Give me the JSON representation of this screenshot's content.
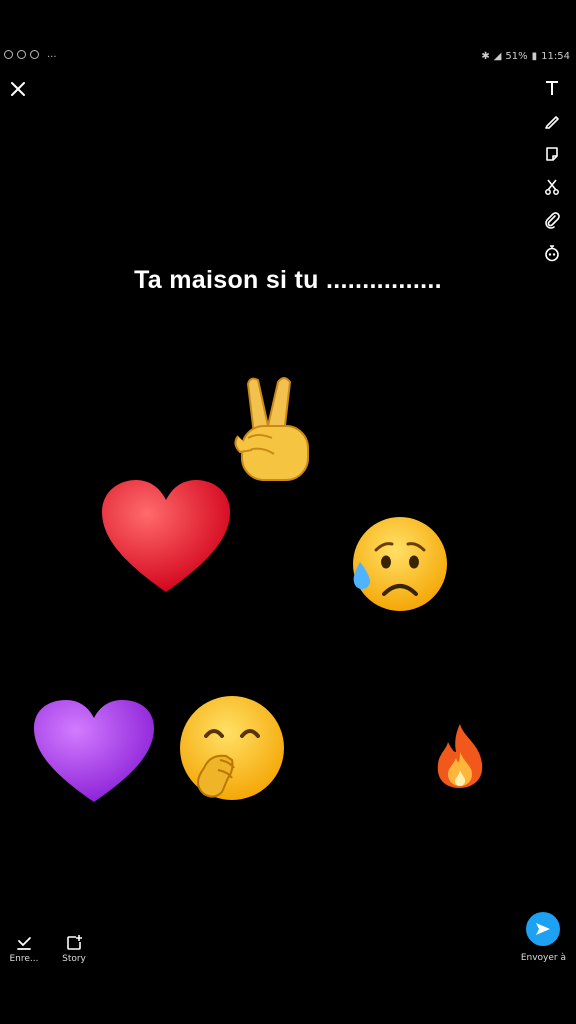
{
  "status": {
    "battery": "51%",
    "time": "11:54",
    "overflow": "..."
  },
  "caption": "Ta maison si tu ................",
  "bottom": {
    "save_label": "Enre...",
    "story_label": "Story",
    "send_label": "Envoyer à"
  },
  "icons": {
    "close": "close-icon",
    "text": "text-icon",
    "pencil": "pencil-icon",
    "sticker": "sticker-icon",
    "scissors": "scissors-icon",
    "attachment": "paperclip-icon",
    "timer": "timer-icon",
    "save": "save-icon",
    "story": "add-story-icon",
    "send": "send-arrow-icon"
  },
  "colors": {
    "accent": "#1da1f2",
    "background": "#000000"
  }
}
